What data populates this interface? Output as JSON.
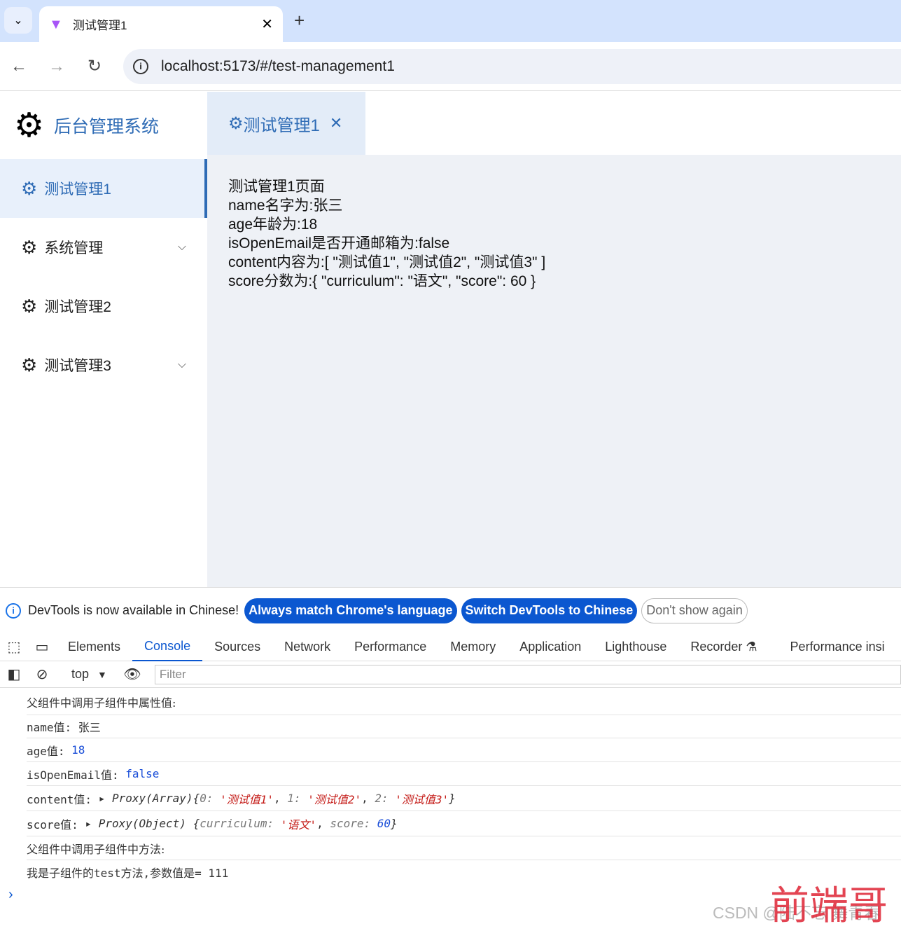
{
  "browser": {
    "tab_title": "测试管理1",
    "url": "localhost:5173/#/test-management1"
  },
  "sidebar": {
    "logo_title": "后台管理系统",
    "items": [
      {
        "label": "测试管理1",
        "active": true
      },
      {
        "label": "系统管理",
        "expandable": true
      },
      {
        "label": "测试管理2"
      },
      {
        "label": "测试管理3",
        "expandable": true
      }
    ]
  },
  "page_tab": {
    "label": "测试管理1"
  },
  "content": {
    "lines": [
      "测试管理1页面",
      "name名字为:张三",
      "age年龄为:18",
      "isOpenEmail是否开通邮箱为:false",
      "content内容为:[ \"测试值1\", \"测试值2\", \"测试值3\" ]",
      "score分数为:{ \"curriculum\": \"语文\", \"score\": 60 }"
    ]
  },
  "devtools": {
    "notice": {
      "text": "DevTools is now available in Chinese!",
      "btn1": "Always match Chrome's language",
      "btn2": "Switch DevTools to Chinese",
      "btn3": "Don't show again"
    },
    "tabs": [
      "Elements",
      "Console",
      "Sources",
      "Network",
      "Performance",
      "Memory",
      "Application",
      "Lighthouse",
      "Recorder",
      "Performance insi"
    ],
    "context": "top",
    "filter_placeholder": "Filter",
    "console": {
      "l1": "父组件中调用子组件中属性值:",
      "l2": "name值: 张三",
      "l3a": "age值: ",
      "l3b": "18",
      "l4a": "isOpenEmail值: ",
      "l4b": "false",
      "l5a": "content值: ",
      "l5b": "Proxy(Array)",
      "l5c": " {",
      "l5d": "0",
      "l5e": "'测试值1'",
      "l5f": "1",
      "l5g": "'测试值2'",
      "l5h": "2",
      "l5i": "'测试值3'",
      "l6a": "score值: ",
      "l6b": "Proxy(Object)",
      "l6d": "curriculum",
      "l6e": "'语文'",
      "l6f": "score",
      "l6g": "60",
      "l7": "父组件中调用子组件中方法:",
      "l8": "我是子组件的test方法,参数值是= 111"
    }
  },
  "watermark": {
    "text": "CSDN @陆不忘 舞青春",
    "stamp": "前端哥"
  }
}
